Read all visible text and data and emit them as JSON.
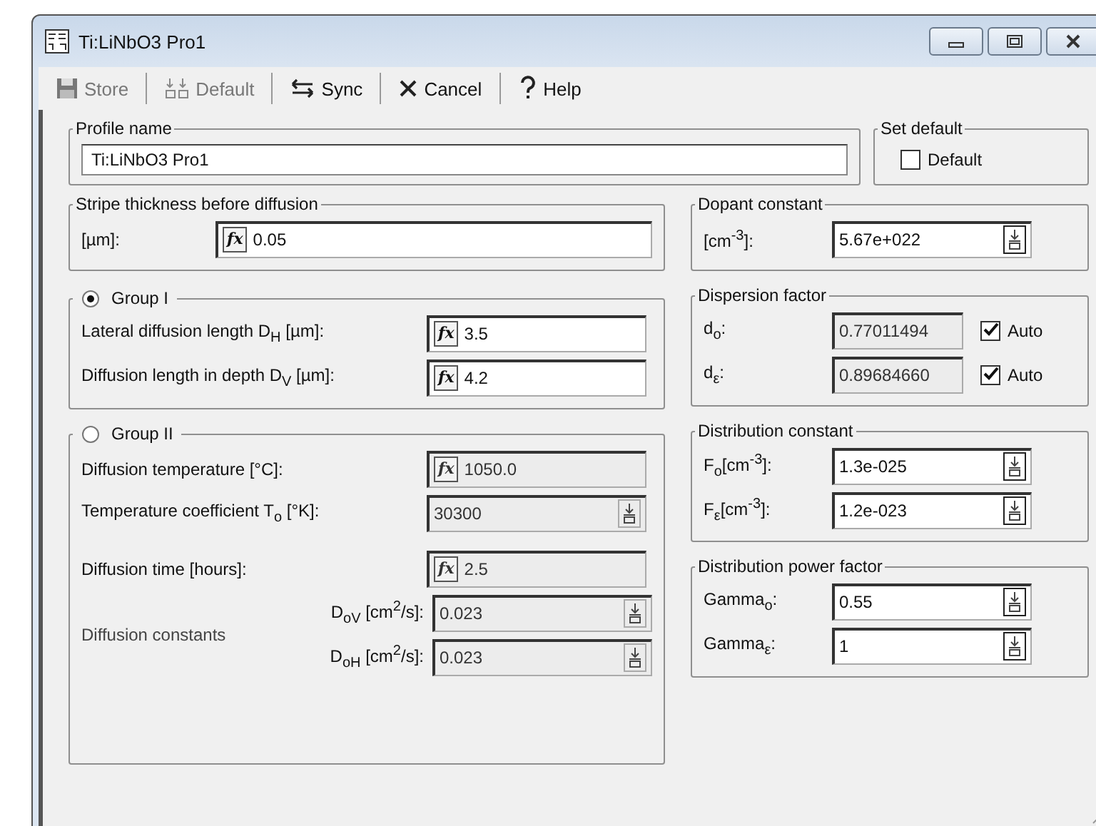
{
  "window": {
    "title": "Ti:LiNbO3 Pro1"
  },
  "toolbar": [
    {
      "label": "Store",
      "kind": "store",
      "disabled": true
    },
    {
      "label": "Default",
      "kind": "default",
      "disabled": true
    },
    {
      "label": "Sync",
      "kind": "sync",
      "disabled": false
    },
    {
      "label": "Cancel",
      "kind": "cancel",
      "disabled": false
    },
    {
      "label": "Help",
      "kind": "help",
      "disabled": false
    }
  ],
  "profile": {
    "legend": "Profile name",
    "value": "Ti:LiNbO3 Pro1"
  },
  "set_default": {
    "legend": "Set default",
    "checkbox": {
      "label": "Default",
      "checked": false
    }
  },
  "left_groups": [
    {
      "legend": "Stripe thickness before diffusion",
      "rows": [
        {
          "label": "[µm]:",
          "field": {
            "kind": "fx",
            "button": "fx",
            "value": "0.05",
            "disabled": false
          }
        }
      ]
    },
    {
      "legend": "Group I",
      "radio": {
        "selected": true
      },
      "rows": [
        {
          "label": "Lateral diffusion length D$_{H}$ [µm]:",
          "field": {
            "kind": "fx",
            "button": "fx",
            "value": "3.5",
            "disabled": false
          }
        },
        {
          "label": "Diffusion length in depth D$_{V}$ [µm]:",
          "field": {
            "kind": "fx",
            "button": "fx",
            "value": "4.2",
            "disabled": false
          }
        }
      ]
    },
    {
      "legend": "Group II",
      "radio": {
        "selected": false
      },
      "rows": [
        {
          "label": "Diffusion temperature  [°C]:",
          "field": {
            "kind": "fx",
            "button": "fx",
            "value": "1050.0",
            "disabled": true
          }
        },
        {
          "label": "Temperature coefficient T$_{o}$ [°K]:",
          "field": {
            "kind": "spin",
            "value": "30300",
            "disabled": true
          }
        },
        {
          "label": "Diffusion time [hours]:",
          "field": {
            "kind": "fx",
            "button": "fx",
            "value": "2.5",
            "disabled": true
          }
        }
      ],
      "sub_group": {
        "label": "Diffusion constants",
        "rows": [
          {
            "label": "D$_{oV}$ [cm$^{2}$/s]:",
            "field": {
              "kind": "spin",
              "value": "0.023",
              "disabled": true
            }
          },
          {
            "label": "D$_{oH}$ [cm$^{2}$/s]:",
            "field": {
              "kind": "spin",
              "value": "0.023",
              "disabled": true
            }
          }
        ]
      }
    }
  ],
  "right_groups": [
    {
      "legend": "Dopant constant",
      "rows": [
        {
          "label": "[cm$^{-3}$]:",
          "field": {
            "kind": "spin",
            "value": "5.67e+022",
            "disabled": false
          }
        }
      ]
    },
    {
      "legend": "Dispersion factor",
      "rows": [
        {
          "label": "d$_{o}$:",
          "field": {
            "kind": "plain",
            "value": "0.77011494",
            "disabled": true
          },
          "auto": {
            "label": "Auto",
            "checked": true
          }
        },
        {
          "label": "d$_{ε}$:",
          "field": {
            "kind": "plain",
            "value": "0.89684660",
            "disabled": true
          },
          "auto": {
            "label": "Auto",
            "checked": true
          }
        }
      ]
    },
    {
      "legend": "Distribution constant",
      "rows": [
        {
          "label": "F$_{o}$[cm$^{-3}$]:",
          "field": {
            "kind": "spin",
            "value": "1.3e-025",
            "disabled": false
          }
        },
        {
          "label": "F$_{ε}$[cm$^{-3}$]:",
          "field": {
            "kind": "spin",
            "value": "1.2e-023",
            "disabled": false
          }
        }
      ]
    },
    {
      "legend": "Distribution power factor",
      "rows": [
        {
          "label": "Gamma$_{o}$:",
          "field": {
            "kind": "spin",
            "value": "0.55",
            "disabled": false
          }
        },
        {
          "label": "Gamma$_{ε}$:",
          "field": {
            "kind": "spin",
            "value": "1",
            "disabled": false
          }
        }
      ]
    }
  ]
}
